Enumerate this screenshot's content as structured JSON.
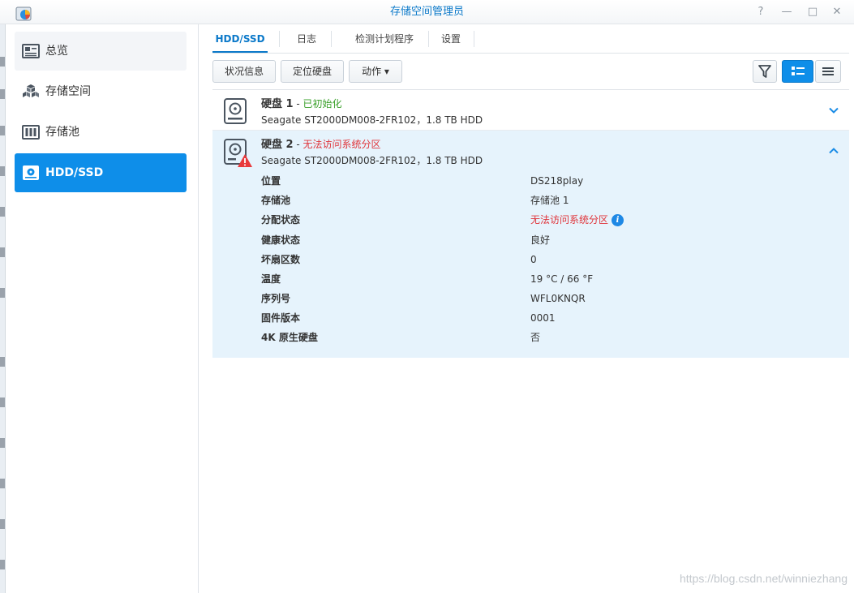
{
  "window": {
    "title": "存储空间管理员",
    "controls": {
      "help": "?",
      "minimize": "—",
      "maximize": "□",
      "close": "✕"
    }
  },
  "sidebar": {
    "items": [
      {
        "label": "总览",
        "icon": "overview-icon"
      },
      {
        "label": "存储空间",
        "icon": "cubes-icon"
      },
      {
        "label": "存储池",
        "icon": "pool-icon"
      },
      {
        "label": "HDD/SSD",
        "icon": "disk-icon",
        "active": true
      }
    ]
  },
  "tabs": [
    {
      "label": "HDD/SSD",
      "active": true
    },
    {
      "label": "日志"
    },
    {
      "label": "检测计划程序"
    },
    {
      "label": "设置"
    }
  ],
  "toolbar": {
    "status_info": "状况信息",
    "locate_disk": "定位硬盘",
    "actions": "动作 ▾"
  },
  "disks": [
    {
      "name": "硬盘 1",
      "status_sep": " - ",
      "status": "已初始化",
      "status_color": "#3aa02a",
      "model": "Seagate ST2000DM008-2FR102，1.8 TB HDD",
      "expanded": false
    },
    {
      "name": "硬盘 2",
      "status_sep": " - ",
      "status": "无法访问系统分区",
      "status_color": "#e0343a",
      "model": "Seagate ST2000DM008-2FR102，1.8 TB HDD",
      "expanded": true,
      "details": [
        {
          "key": "位置",
          "value": "DS218play"
        },
        {
          "key": "存储池",
          "value": "存储池 1"
        },
        {
          "key": "分配状态",
          "value": "无法访问系统分区",
          "value_color": "#e0343a",
          "info": true
        },
        {
          "key": "健康状态",
          "value": "良好",
          "value_color": "#3aa02a"
        },
        {
          "key": "坏扇区数",
          "value": "0"
        },
        {
          "key": "温度",
          "value": "19 °C / 66 °F"
        },
        {
          "key": "序列号",
          "value": "WFL0KNQR"
        },
        {
          "key": "固件版本",
          "value": "0001"
        },
        {
          "key": "4K 原生硬盘",
          "value": "否"
        }
      ]
    }
  ],
  "watermark": "https://blog.csdn.net/winniezhang"
}
